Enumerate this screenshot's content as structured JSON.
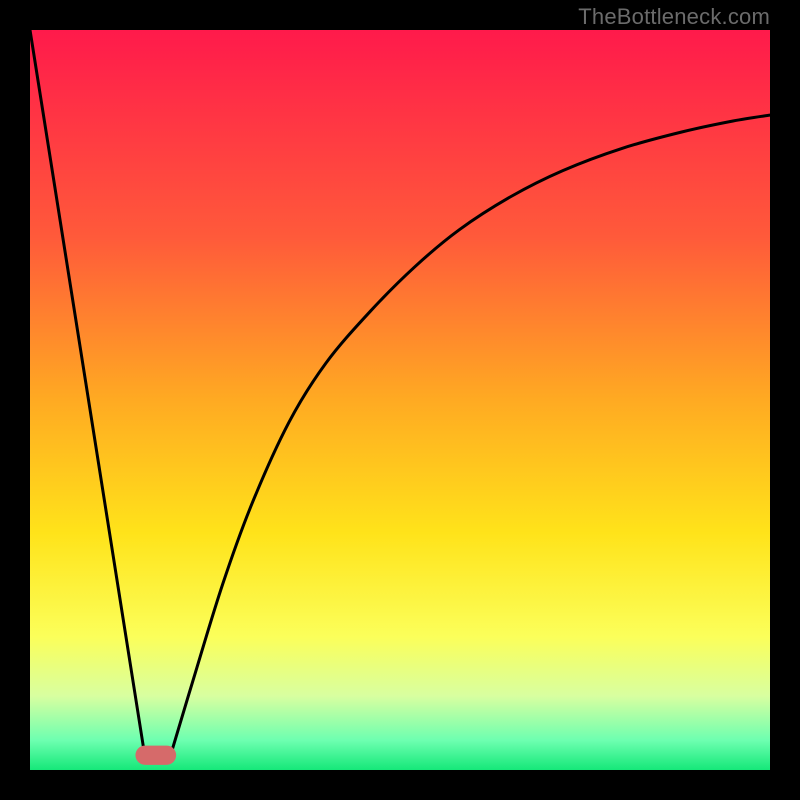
{
  "watermark": "TheBottleneck.com",
  "chart_data": {
    "type": "line",
    "title": "",
    "xlabel": "",
    "ylabel": "",
    "xlim": [
      0,
      100
    ],
    "ylim": [
      0,
      100
    ],
    "gradient_stops": [
      {
        "offset": 0,
        "color": "#ff1a4b"
      },
      {
        "offset": 28,
        "color": "#ff5a3a"
      },
      {
        "offset": 50,
        "color": "#ffaa22"
      },
      {
        "offset": 68,
        "color": "#ffe31a"
      },
      {
        "offset": 82,
        "color": "#fbff5a"
      },
      {
        "offset": 90,
        "color": "#d8ffa0"
      },
      {
        "offset": 96,
        "color": "#6dffb0"
      },
      {
        "offset": 100,
        "color": "#15e879"
      }
    ],
    "series": [
      {
        "name": "left-descent",
        "x": [
          0,
          15.5
        ],
        "y": [
          100,
          2
        ]
      },
      {
        "name": "right-asymptote",
        "x": [
          19,
          22,
          26,
          30,
          35,
          40,
          46,
          52,
          58,
          65,
          72,
          80,
          88,
          95,
          100
        ],
        "y": [
          2,
          12,
          25,
          36,
          47,
          55,
          62,
          68,
          73,
          77.5,
          81,
          84,
          86.2,
          87.7,
          88.5
        ]
      }
    ],
    "marker": {
      "name": "minimum-pill",
      "x": 17,
      "y": 2,
      "width": 5.5,
      "height": 2.6,
      "rx": 1.3,
      "color": "#d66a6a"
    }
  }
}
